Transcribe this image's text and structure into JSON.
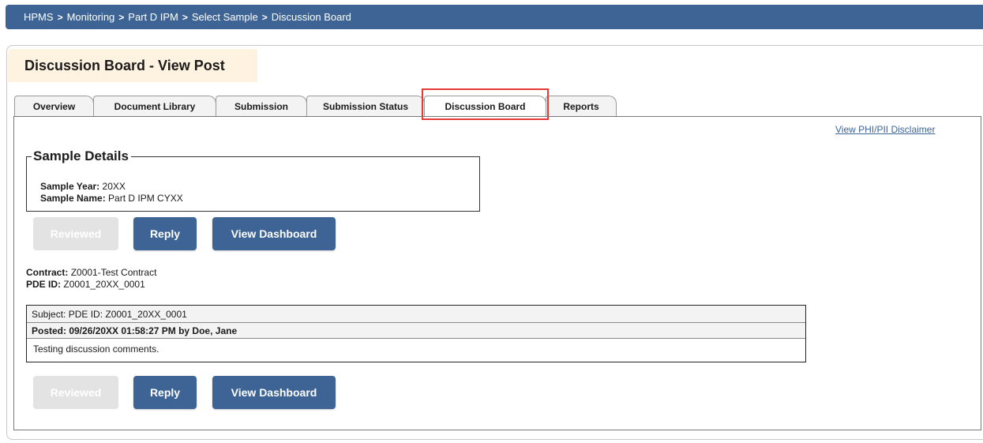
{
  "breadcrumb": [
    "HPMS",
    "Monitoring",
    "Part D IPM",
    "Select Sample",
    "Discussion Board"
  ],
  "page_title": "Discussion Board - View Post",
  "tabs": [
    {
      "label": "Overview",
      "active": false
    },
    {
      "label": "Document Library",
      "active": false
    },
    {
      "label": "Submission",
      "active": false
    },
    {
      "label": "Submission Status",
      "active": false
    },
    {
      "label": "Discussion Board",
      "active": true
    },
    {
      "label": "Reports",
      "active": false
    }
  ],
  "disclaimer_link": "View PHI/PII Disclaimer",
  "sample_details": {
    "legend": "Sample Details",
    "year_label": "Sample Year:",
    "year_value": "20XX",
    "name_label": "Sample Name:",
    "name_value": "Part D IPM CYXX"
  },
  "buttons": {
    "reviewed": "Reviewed",
    "reply": "Reply",
    "view_dashboard": "View Dashboard"
  },
  "contract": {
    "label": "Contract:",
    "value": "Z0001-Test Contract"
  },
  "pde": {
    "label": "PDE ID:",
    "value": "Z0001_20XX_0001"
  },
  "post": {
    "subject": "Subject: PDE ID: Z0001_20XX_0001",
    "posted": "Posted:  09/26/20XX 01:58:27 PM by Doe, Jane",
    "body": "Testing discussion comments."
  },
  "colors": {
    "primary": "#3d6495",
    "title_bg": "#fdf3e0",
    "highlight": "#e53935"
  }
}
